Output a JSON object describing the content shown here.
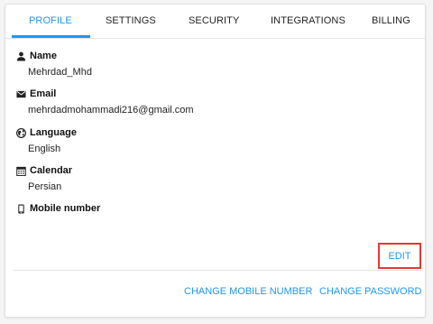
{
  "tabs": [
    {
      "label": "PROFILE",
      "active": true
    },
    {
      "label": "SETTINGS",
      "active": false
    },
    {
      "label": "SECURITY",
      "active": false
    },
    {
      "label": "INTEGRATIONS",
      "active": false
    },
    {
      "label": "BILLING",
      "active": false
    }
  ],
  "profile": {
    "name": {
      "label": "Name",
      "value": "Mehrdad_Mhd",
      "icon": "person-icon"
    },
    "email": {
      "label": "Email",
      "value": "mehrdadmohammadi216@gmail.com",
      "icon": "mail-icon"
    },
    "language": {
      "label": "Language",
      "value": "English",
      "icon": "globe-icon"
    },
    "calendar": {
      "label": "Calendar",
      "value": "Persian",
      "icon": "calendar-icon"
    },
    "mobile": {
      "label": "Mobile number",
      "value": "",
      "icon": "phone-icon"
    }
  },
  "actions": {
    "edit": "EDIT",
    "change_mobile": "CHANGE MOBILE NUMBER",
    "change_password": "CHANGE PASSWORD"
  },
  "colors": {
    "accent": "#2196f3",
    "highlight": "#e53935"
  }
}
